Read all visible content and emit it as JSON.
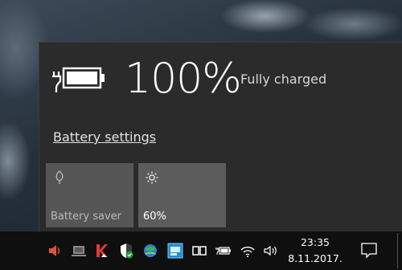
{
  "battery": {
    "percent_text": "100%",
    "status": "Fully charged",
    "settings_link": "Battery settings"
  },
  "quick_actions": [
    {
      "label": "Battery saver",
      "icon": "leaf-icon",
      "active": false
    },
    {
      "label": "60%",
      "icon": "sun-brightness-icon",
      "active": true
    }
  ],
  "tray": {
    "icons": [
      "speaker-muted-red-icon",
      "network-pc-icon",
      "kaspersky-icon",
      "windows-defender-shield-icon",
      "globe-sync-icon",
      "blue-app-icon",
      "reader-book-icon",
      "battery-plugged-icon",
      "wifi-icon",
      "volume-icon"
    ],
    "time": "23:35",
    "date": "8.11.2017."
  },
  "colors": {
    "flyout_bg": "#2b2b2b",
    "tile_bg": "#5a5a5a",
    "taskbar_bg": "#0f0f10"
  }
}
